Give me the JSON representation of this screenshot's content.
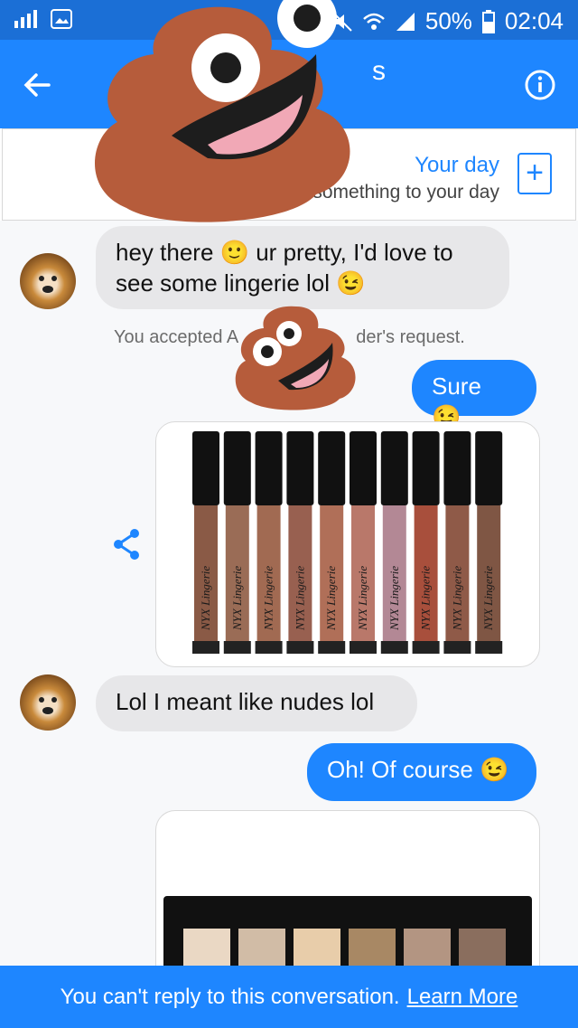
{
  "status_bar": {
    "battery": "50%",
    "time": "02:04"
  },
  "header": {
    "title_fragment": "s"
  },
  "your_day": {
    "title": "Your day",
    "subtitle": "Add something to your day",
    "add_label": "+"
  },
  "messages": [
    {
      "from": "other",
      "text": "hey there 🙂 ur pretty, I'd love to see some lingerie lol 😉"
    },
    {
      "type": "system",
      "text_left": "You accepted A",
      "text_right": "der's request."
    },
    {
      "from": "me",
      "text": "Sure 😉"
    },
    {
      "type": "image",
      "description": "lipsticks"
    },
    {
      "from": "other",
      "text": "Lol I meant like nudes lol"
    },
    {
      "from": "me",
      "text": "Oh! Of course 😉"
    },
    {
      "type": "image",
      "description": "eyeshadow palette"
    }
  ],
  "footer": {
    "text": "You can't reply to this conversation.",
    "link": "Learn More"
  },
  "lipstick_label": "NYX Lingerie",
  "lipstick_colors": [
    "#8a5a46",
    "#9a6c56",
    "#a16a52",
    "#986050",
    "#b06f58",
    "#b9786a",
    "#b38895",
    "#a84f3c",
    "#8f5a48",
    "#7f5644"
  ],
  "palette_colors": [
    "#ead8c4",
    "#d1bca6",
    "#e8cdaa",
    "#a88864",
    "#b39582",
    "#8a6e5e"
  ],
  "accent": "#1e86ff"
}
